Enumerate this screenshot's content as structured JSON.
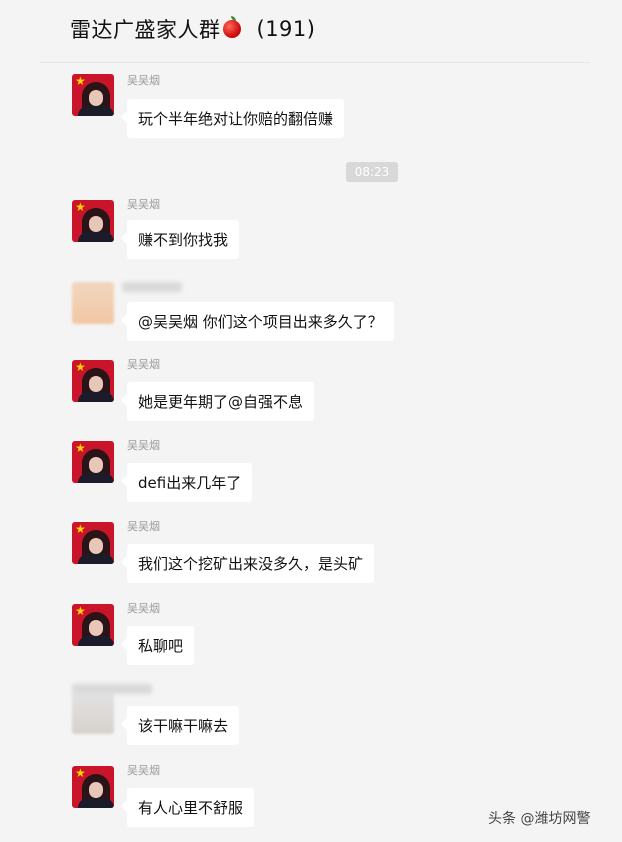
{
  "header": {
    "title": "雷达广盛家人群",
    "member_count": "(191)"
  },
  "time_separator": "08:23",
  "messages": [
    {
      "sender": "吴吴烟",
      "text": "玩个半年绝对让你赔的翻倍赚"
    },
    {
      "sender": "吴吴烟",
      "text": "赚不到你找我"
    },
    {
      "sender": "",
      "text": "@吴吴烟 你们这个项目出来多久了？"
    },
    {
      "sender": "吴吴烟",
      "text": "她是更年期了@自强不息"
    },
    {
      "sender": "吴吴烟",
      "text": "defi出来几年了"
    },
    {
      "sender": "吴吴烟",
      "text": "我们这个挖矿出来没多久，是头矿"
    },
    {
      "sender": "吴吴烟",
      "text": "私聊吧"
    },
    {
      "sender": "",
      "text": "该干嘛干嘛去"
    },
    {
      "sender": "吴吴烟",
      "text": "有人心里不舒服"
    }
  ],
  "watermark": "头条 @潍坊网警"
}
